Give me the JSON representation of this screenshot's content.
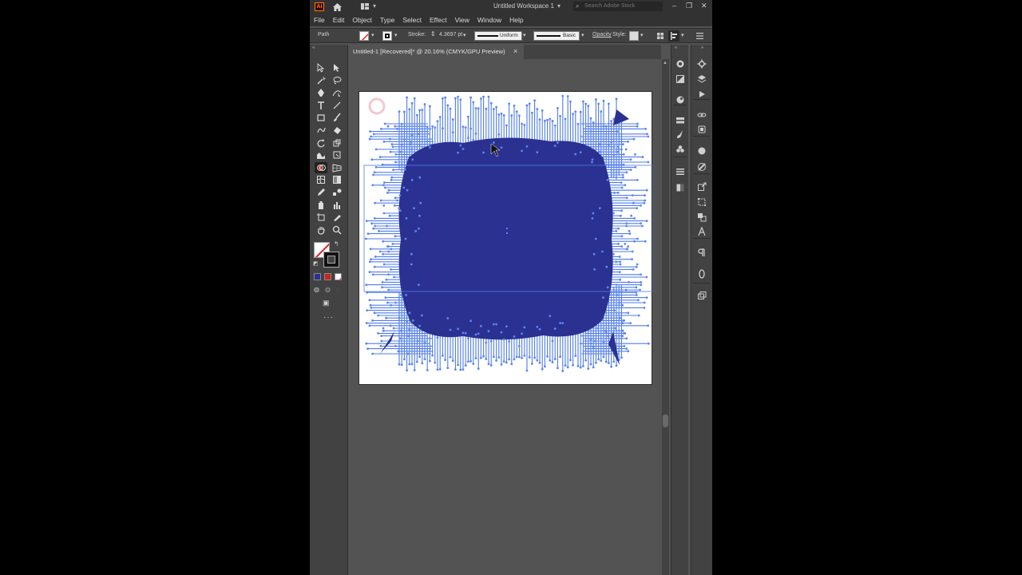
{
  "app": {
    "logo": "Ai",
    "workspace": "Untitled Workspace 1",
    "search_placeholder": "Search Adobe Stock"
  },
  "menu": [
    "File",
    "Edit",
    "Object",
    "Type",
    "Select",
    "Effect",
    "View",
    "Window",
    "Help"
  ],
  "control": {
    "selection": "Path",
    "stroke_label": "Stroke:",
    "stroke_value": "4.3697 pt",
    "profile": "Uniform",
    "brush": "Basic",
    "opacity_label": "Opacity",
    "style_label": "Style:"
  },
  "document": {
    "tab_title": "Untitled-1 [Recovered]* @ 20.16% (CMYK/GPU Preview)",
    "close": "×"
  },
  "colors": {
    "fill_art": "#2b3191",
    "path_blue": "#4f7bea",
    "anchor": "#5a86f0",
    "app_bg": "#535353",
    "panel_bg": "#424242",
    "accent": "#ff7c00"
  },
  "icons": {
    "toolbar": [
      "selection-icon",
      "direct-selection-icon",
      "magic-wand-icon",
      "lasso-icon",
      "pen-icon",
      "curvature-icon",
      "type-icon",
      "line-icon",
      "rectangle-icon",
      "paintbrush-icon",
      "shaper-icon",
      "eraser-icon",
      "rotate-icon",
      "scale-icon",
      "warp-icon",
      "free-transform-icon",
      "shape-builder-icon",
      "perspective-icon",
      "mesh-icon",
      "gradient-icon",
      "eyedropper-icon",
      "blend-icon",
      "symbol-sprayer-icon",
      "column-graph-icon",
      "artboard-icon",
      "slice-icon",
      "hand-icon",
      "zoom-icon"
    ],
    "panels_left": [
      "color-guide-icon",
      "gradient-panel-icon",
      "appearance-icon",
      "swatches-icon",
      "brushes-icon",
      "symbols-icon",
      "align-icon",
      "transparency-icon"
    ],
    "panels_right": [
      "properties-icon",
      "layers-icon",
      "actions-icon",
      "links-icon",
      "libraries-icon",
      "graphic-styles-icon",
      "stroke-panel-icon",
      "export-icon",
      "transform-icon",
      "pathfinder-icon",
      "character-icon",
      "paragraph-icon",
      "opentype-icon",
      "asset-export-icon"
    ]
  }
}
